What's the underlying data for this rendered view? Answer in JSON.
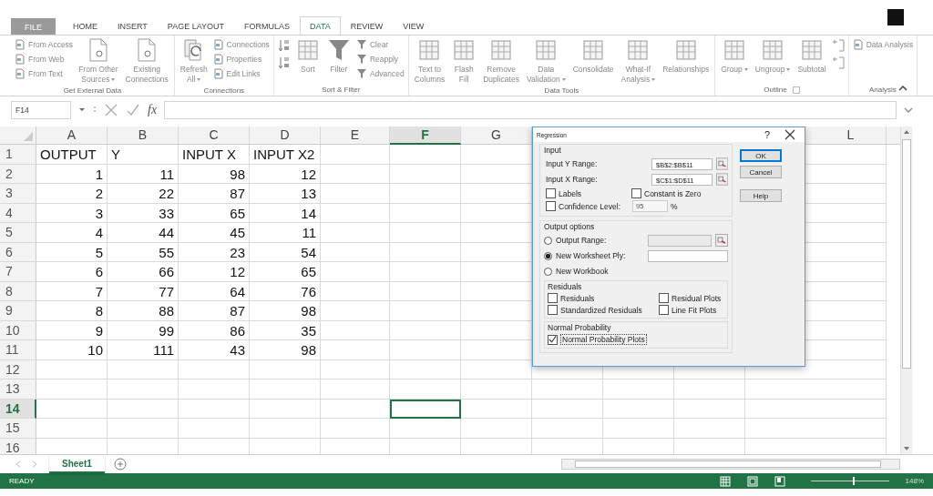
{
  "ribbon_tabs": [
    {
      "label": "FILE",
      "kind": "file",
      "selected": false
    },
    {
      "label": "HOME",
      "kind": "tab",
      "selected": false
    },
    {
      "label": "INSERT",
      "kind": "tab",
      "selected": false
    },
    {
      "label": "PAGE LAYOUT",
      "kind": "tab",
      "selected": false
    },
    {
      "label": "FORMULAS",
      "kind": "tab",
      "selected": false
    },
    {
      "label": "DATA",
      "kind": "tab",
      "selected": true
    },
    {
      "label": "REVIEW",
      "kind": "tab",
      "selected": false
    },
    {
      "label": "VIEW",
      "kind": "tab",
      "selected": false
    }
  ],
  "ribbon_groups": [
    {
      "label": "Get External Data",
      "controls": [
        {
          "kind": "stack",
          "items": [
            {
              "kind": "text",
              "label": "From Access"
            },
            {
              "kind": "text",
              "label": "From Web"
            },
            {
              "kind": "text",
              "label": "From Text"
            }
          ]
        },
        {
          "kind": "large",
          "lines": [
            "From Other",
            "Sources"
          ],
          "dropdown": true
        },
        {
          "kind": "large",
          "lines": [
            "Existing",
            "Connections"
          ]
        }
      ]
    },
    {
      "label": "Connections",
      "controls": [
        {
          "kind": "large",
          "lines": [
            "Refresh",
            "All"
          ],
          "dropdown": true
        },
        {
          "kind": "stack",
          "items": [
            {
              "kind": "text",
              "label": "Connections"
            },
            {
              "kind": "text",
              "label": "Properties"
            },
            {
              "kind": "text",
              "label": "Edit Links"
            }
          ]
        }
      ]
    },
    {
      "label": "Sort & Filter",
      "controls": [
        {
          "kind": "stack",
          "items": [
            {
              "kind": "icon"
            },
            {
              "kind": "icon"
            }
          ]
        },
        {
          "kind": "large",
          "lines": [
            "Sort"
          ]
        },
        {
          "kind": "large",
          "lines": [
            "Filter"
          ]
        },
        {
          "kind": "stack",
          "items": [
            {
              "kind": "text",
              "label": "Clear"
            },
            {
              "kind": "text",
              "label": "Reapply"
            },
            {
              "kind": "text",
              "label": "Advanced"
            }
          ]
        }
      ]
    },
    {
      "label": "Data Tools",
      "controls": [
        {
          "kind": "large",
          "lines": [
            "Text to",
            "Columns"
          ]
        },
        {
          "kind": "large",
          "lines": [
            "Flash",
            "Fill"
          ]
        },
        {
          "kind": "large",
          "lines": [
            "Remove",
            "Duplicates"
          ]
        },
        {
          "kind": "large",
          "lines": [
            "Data",
            "Validation"
          ],
          "dropdown": true
        },
        {
          "kind": "large",
          "lines": [
            "Consolidate"
          ]
        },
        {
          "kind": "large",
          "lines": [
            "What-If",
            "Analysis"
          ],
          "dropdown": true
        },
        {
          "kind": "large",
          "lines": [
            "Relationships"
          ]
        }
      ]
    },
    {
      "label": "Outline",
      "launcher": true,
      "controls": [
        {
          "kind": "large",
          "lines": [
            "Group"
          ],
          "dropdown": true
        },
        {
          "kind": "large",
          "lines": [
            "Ungroup"
          ],
          "dropdown": true
        },
        {
          "kind": "large",
          "lines": [
            "Subtotal"
          ]
        },
        {
          "kind": "stack",
          "items": [
            {
              "kind": "icon"
            },
            {
              "kind": "icon"
            }
          ]
        }
      ]
    },
    {
      "label": "Analysis",
      "controls": [
        {
          "kind": "stack",
          "items": [
            {
              "kind": "text",
              "label": "Data Analysis"
            }
          ]
        }
      ]
    }
  ],
  "formula_bar": {
    "name_box": "F14",
    "function_label": "fx"
  },
  "columns": [
    {
      "label": "A",
      "selected": false
    },
    {
      "label": "B",
      "selected": false
    },
    {
      "label": "C",
      "selected": false
    },
    {
      "label": "D",
      "selected": false
    },
    {
      "label": "E",
      "selected": false
    },
    {
      "label": "F",
      "selected": true
    },
    {
      "label": "G",
      "selected": false
    },
    {
      "label": "L",
      "selected": false
    }
  ],
  "rows": [
    {
      "header": "1",
      "selected": false,
      "kind": "labels",
      "cells": [
        "OUTPUT",
        "Y",
        "INPUT X",
        "INPUT X2"
      ]
    },
    {
      "header": "2",
      "selected": false,
      "kind": "numbers",
      "cells": [
        "1",
        "11",
        "98",
        "12"
      ]
    },
    {
      "header": "3",
      "selected": false,
      "kind": "numbers",
      "cells": [
        "2",
        "22",
        "87",
        "13"
      ]
    },
    {
      "header": "4",
      "selected": false,
      "kind": "numbers",
      "cells": [
        "3",
        "33",
        "65",
        "14"
      ]
    },
    {
      "header": "5",
      "selected": false,
      "kind": "numbers",
      "cells": [
        "4",
        "44",
        "45",
        "11"
      ]
    },
    {
      "header": "6",
      "selected": false,
      "kind": "numbers",
      "cells": [
        "5",
        "55",
        "23",
        "54"
      ]
    },
    {
      "header": "7",
      "selected": false,
      "kind": "numbers",
      "cells": [
        "6",
        "66",
        "12",
        "65"
      ]
    },
    {
      "header": "8",
      "selected": false,
      "kind": "numbers",
      "cells": [
        "7",
        "77",
        "64",
        "76"
      ]
    },
    {
      "header": "9",
      "selected": false,
      "kind": "numbers",
      "cells": [
        "8",
        "88",
        "87",
        "98"
      ]
    },
    {
      "header": "10",
      "selected": false,
      "kind": "numbers",
      "cells": [
        "9",
        "99",
        "86",
        "35"
      ]
    },
    {
      "header": "11",
      "selected": false,
      "kind": "numbers",
      "cells": [
        "10",
        "111",
        "43",
        "98"
      ]
    },
    {
      "header": "12",
      "selected": false
    },
    {
      "header": "13",
      "selected": false
    },
    {
      "header": "14",
      "selected": true
    },
    {
      "header": "15",
      "selected": false
    },
    {
      "header": "16",
      "selected": false
    }
  ],
  "dialog": {
    "title": "Regression",
    "help": "?",
    "input": {
      "title": "Input",
      "fields": [
        {
          "label": "Input Y Range:",
          "value": "$B$2:$B$11"
        },
        {
          "label": "Input X Range:",
          "value": "$C$1:$D$11"
        }
      ],
      "options": [
        {
          "label": "Labels",
          "checked": false
        },
        {
          "label": "Constant is Zero",
          "checked": false
        },
        {
          "label": "Confidence Level:",
          "checked": false,
          "value": "95",
          "unit": "%"
        }
      ]
    },
    "output": {
      "title": "Output options",
      "choices": [
        {
          "label": "Output Range:",
          "selected": false,
          "kind": "range"
        },
        {
          "label": "New Worksheet Ply:",
          "selected": true,
          "kind": "text"
        },
        {
          "label": "New Workbook",
          "selected": false,
          "kind": "plain"
        }
      ],
      "residuals_title": "Residuals",
      "residuals": [
        {
          "label": "Residuals",
          "checked": false
        },
        {
          "label": "Residual Plots",
          "checked": false
        },
        {
          "label": "Standardized Residuals",
          "checked": false
        },
        {
          "label": "Line Fit Plots",
          "checked": false
        }
      ],
      "probability_title": "Normal Probability",
      "probability": [
        {
          "label": "Normal Probability Plots",
          "checked": true
        }
      ]
    },
    "buttons": [
      {
        "label": "OK",
        "default": true
      },
      {
        "label": "Cancel",
        "default": false
      },
      {
        "label": "Help",
        "default": false
      }
    ]
  },
  "sheet_tabs": [
    {
      "label": "Sheet1",
      "selected": true
    }
  ],
  "status_bar": {
    "status": "READY",
    "zoom": {
      "level": 0.54,
      "reading": "148%"
    }
  }
}
